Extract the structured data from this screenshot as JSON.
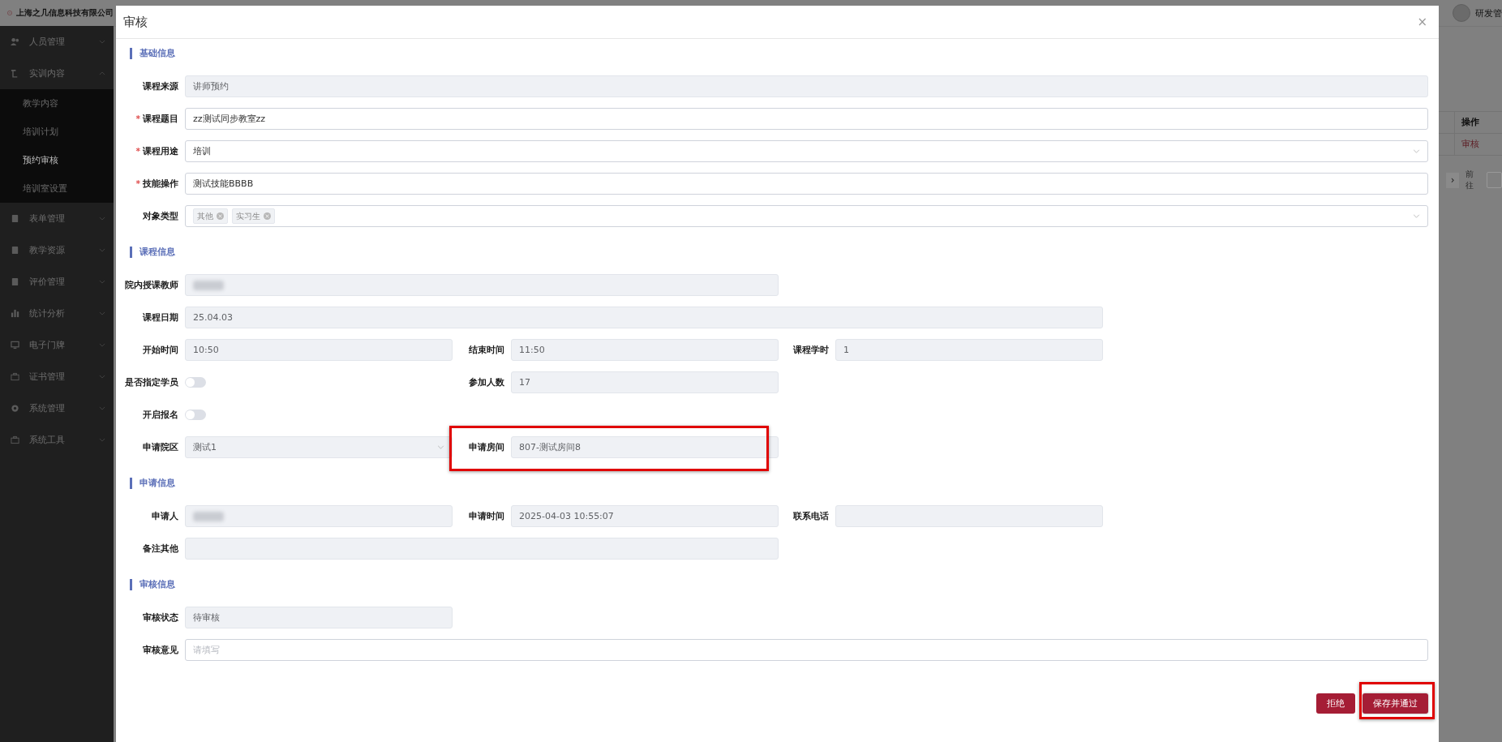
{
  "company": "上海之几信息科技有限公司",
  "user": {
    "name": "研发管"
  },
  "sidebar": {
    "items": [
      {
        "label": "人员管理",
        "expanded": false
      },
      {
        "label": "实训内容",
        "expanded": true,
        "children": [
          {
            "label": "教学内容",
            "selected": false
          },
          {
            "label": "培训计划",
            "selected": false
          },
          {
            "label": "预约审核",
            "selected": true
          },
          {
            "label": "培训室设置",
            "selected": false
          }
        ]
      },
      {
        "label": "表单管理",
        "expanded": false
      },
      {
        "label": "教学资源",
        "expanded": false
      },
      {
        "label": "评价管理",
        "expanded": false
      },
      {
        "label": "统计分析",
        "expanded": false
      },
      {
        "label": "电子门牌",
        "expanded": false
      },
      {
        "label": "证书管理",
        "expanded": false
      },
      {
        "label": "系统管理",
        "expanded": false
      },
      {
        "label": "系统工具",
        "expanded": false
      }
    ]
  },
  "background_table": {
    "columns": [
      "操作"
    ],
    "rows": [
      [
        "审核"
      ]
    ]
  },
  "background_pager": {
    "next": "›",
    "goto_label": "前往"
  },
  "dialog": {
    "title": "审核",
    "close": "×",
    "sections": [
      {
        "title": "基础信息",
        "rows": [
          [
            {
              "label": "课程来源",
              "kind": "input",
              "value": "讲师预约",
              "disabled": true
            }
          ],
          [
            {
              "label": "课程题目",
              "required_mark": "*",
              "kind": "input",
              "value": "zz测试同步教室zz",
              "disabled": false
            }
          ],
          [
            {
              "label": "课程用途",
              "required_mark": "*",
              "kind": "select",
              "value": "培训",
              "disabled": false
            }
          ],
          [
            {
              "label": "技能操作",
              "required_mark": "*",
              "kind": "input",
              "value": "测试技能BBBB",
              "disabled": false
            }
          ],
          [
            {
              "label": "对象类型",
              "kind": "tags",
              "tags": [
                "其他",
                "实习生"
              ],
              "disabled": false
            }
          ]
        ]
      },
      {
        "title": "课程信息",
        "rows": [
          [
            {
              "label": "院内授课教师",
              "kind": "blurred",
              "disabled": true
            }
          ],
          [
            {
              "label": "课程日期",
              "kind": "input",
              "value": "25.04.03",
              "disabled": true
            }
          ],
          [
            {
              "label": "开始时间",
              "kind": "input",
              "value": "10:50",
              "disabled": true
            },
            {
              "label": "结束时间",
              "kind": "input",
              "value": "11:50",
              "disabled": true
            },
            {
              "label": "课程学时",
              "kind": "input",
              "value": "1",
              "disabled": true
            }
          ],
          [
            {
              "label": "是否指定学员",
              "kind": "toggle",
              "on": false
            },
            {
              "label": "参加人数",
              "kind": "input",
              "value": "17",
              "disabled": true
            }
          ],
          [
            {
              "label": "开启报名",
              "kind": "toggle",
              "on": false
            }
          ],
          [
            {
              "label": "申请院区",
              "kind": "select",
              "value": "测试1",
              "disabled": true
            },
            {
              "label": "申请房间",
              "kind": "input",
              "value": "807-测试房间8",
              "disabled": true,
              "highlighted": true
            }
          ]
        ]
      },
      {
        "title": "申请信息",
        "rows": [
          [
            {
              "label": "申请人",
              "kind": "blurred",
              "disabled": true
            },
            {
              "label": "申请时间",
              "kind": "input",
              "value": "2025-04-03 10:55:07",
              "disabled": true
            },
            {
              "label": "联系电话",
              "kind": "input",
              "disabled": true
            }
          ],
          [
            {
              "label": "备注其他",
              "kind": "input",
              "disabled": true
            }
          ]
        ]
      },
      {
        "title": "审核信息",
        "rows": [
          [
            {
              "label": "审核状态",
              "kind": "input",
              "value": "待审核",
              "disabled": true
            }
          ],
          [
            {
              "label": "审核意见",
              "kind": "input",
              "placeholder": "请填写",
              "disabled": false
            }
          ]
        ]
      }
    ],
    "buttons": [
      {
        "label": "拒绝",
        "highlighted": false
      },
      {
        "label": "保存并通过",
        "highlighted": true
      }
    ]
  }
}
